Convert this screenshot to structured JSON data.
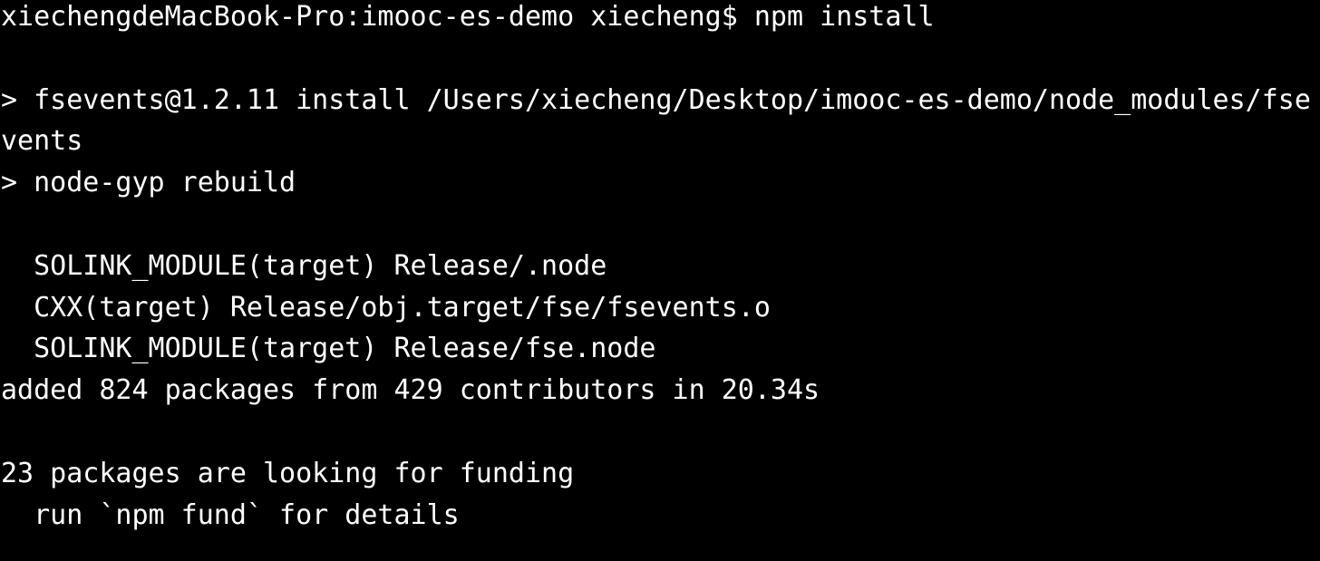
{
  "terminal": {
    "lines": [
      "xiechengdeMacBook-Pro:imooc-es-demo xiecheng$ npm install",
      "",
      "> fsevents@1.2.11 install /Users/xiecheng/Desktop/imooc-es-demo/node_modules/fse",
      "vents",
      "> node-gyp rebuild",
      "",
      "  SOLINK_MODULE(target) Release/.node",
      "  CXX(target) Release/obj.target/fse/fsevents.o",
      "  SOLINK_MODULE(target) Release/fse.node",
      "added 824 packages from 429 contributors in 20.34s",
      "",
      "23 packages are looking for funding",
      "  run `npm fund` for details"
    ]
  },
  "colors": {
    "background": "#000000",
    "foreground": "#ffffff"
  }
}
